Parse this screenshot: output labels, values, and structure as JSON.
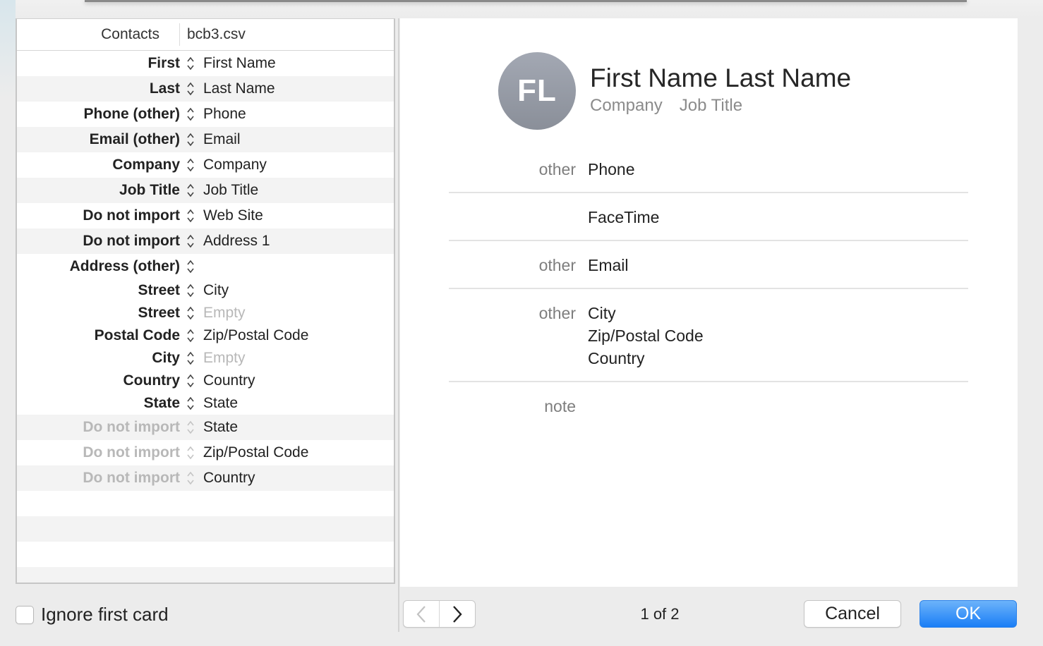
{
  "mapping": {
    "header": {
      "contacts_label": "Contacts",
      "file_label": "bcb3.csv"
    },
    "rows": [
      {
        "field": "First",
        "source": "First Name",
        "dim": false,
        "empty": false,
        "stripe": false,
        "compact": false
      },
      {
        "field": "Last",
        "source": "Last Name",
        "dim": false,
        "empty": false,
        "stripe": true,
        "compact": false
      },
      {
        "field": "Phone (other)",
        "source": "Phone",
        "dim": false,
        "empty": false,
        "stripe": false,
        "compact": false
      },
      {
        "field": "Email (other)",
        "source": "Email",
        "dim": false,
        "empty": false,
        "stripe": true,
        "compact": false
      },
      {
        "field": "Company",
        "source": "Company",
        "dim": false,
        "empty": false,
        "stripe": false,
        "compact": false
      },
      {
        "field": "Job Title",
        "source": "Job Title",
        "dim": false,
        "empty": false,
        "stripe": true,
        "compact": false
      },
      {
        "field": "Do not import",
        "source": "Web Site",
        "dim": false,
        "empty": false,
        "stripe": false,
        "compact": false
      },
      {
        "field": "Do not import",
        "source": "Address 1",
        "dim": false,
        "empty": false,
        "stripe": true,
        "compact": false
      },
      {
        "field": "Address (other)",
        "source": "",
        "dim": false,
        "empty": false,
        "stripe": false,
        "compact": false
      },
      {
        "field": "Street",
        "source": "City",
        "dim": false,
        "empty": false,
        "stripe": false,
        "compact": true
      },
      {
        "field": "Street",
        "source": "Empty",
        "dim": false,
        "empty": true,
        "stripe": false,
        "compact": true
      },
      {
        "field": "Postal Code",
        "source": "Zip/Postal Code",
        "dim": false,
        "empty": false,
        "stripe": false,
        "compact": true
      },
      {
        "field": "City",
        "source": "Empty",
        "dim": false,
        "empty": true,
        "stripe": false,
        "compact": true
      },
      {
        "field": "Country",
        "source": "Country",
        "dim": false,
        "empty": false,
        "stripe": false,
        "compact": true
      },
      {
        "field": "State",
        "source": "State",
        "dim": false,
        "empty": false,
        "stripe": false,
        "compact": true
      },
      {
        "field": "Do not import",
        "source": "State",
        "dim": true,
        "empty": false,
        "stripe": true,
        "compact": false
      },
      {
        "field": "Do not import",
        "source": "Zip/Postal Code",
        "dim": true,
        "empty": false,
        "stripe": false,
        "compact": false
      },
      {
        "field": "Do not import",
        "source": "Country",
        "dim": true,
        "empty": false,
        "stripe": true,
        "compact": false
      }
    ]
  },
  "ignore_first_card": {
    "label": "Ignore first card",
    "checked": false
  },
  "card": {
    "initials": "FL",
    "name": "First Name Last Name",
    "company": "Company",
    "job_title": "Job Title",
    "details": [
      {
        "label": "other",
        "values": [
          "Phone"
        ]
      },
      {
        "label": "",
        "values": [
          "FaceTime"
        ]
      },
      {
        "label": "other",
        "values": [
          "Email"
        ]
      },
      {
        "label": "other",
        "values": [
          "City",
          "Zip/Postal Code",
          "Country"
        ]
      },
      {
        "label": "note",
        "values": []
      }
    ]
  },
  "pager": {
    "text": "1 of 2",
    "prev_enabled": false,
    "next_enabled": true
  },
  "buttons": {
    "cancel": "Cancel",
    "ok": "OK"
  },
  "colors": {
    "accent": "#1a7ef6",
    "dim_text": "#b8b8b8",
    "stripe": "#f3f3f3"
  }
}
